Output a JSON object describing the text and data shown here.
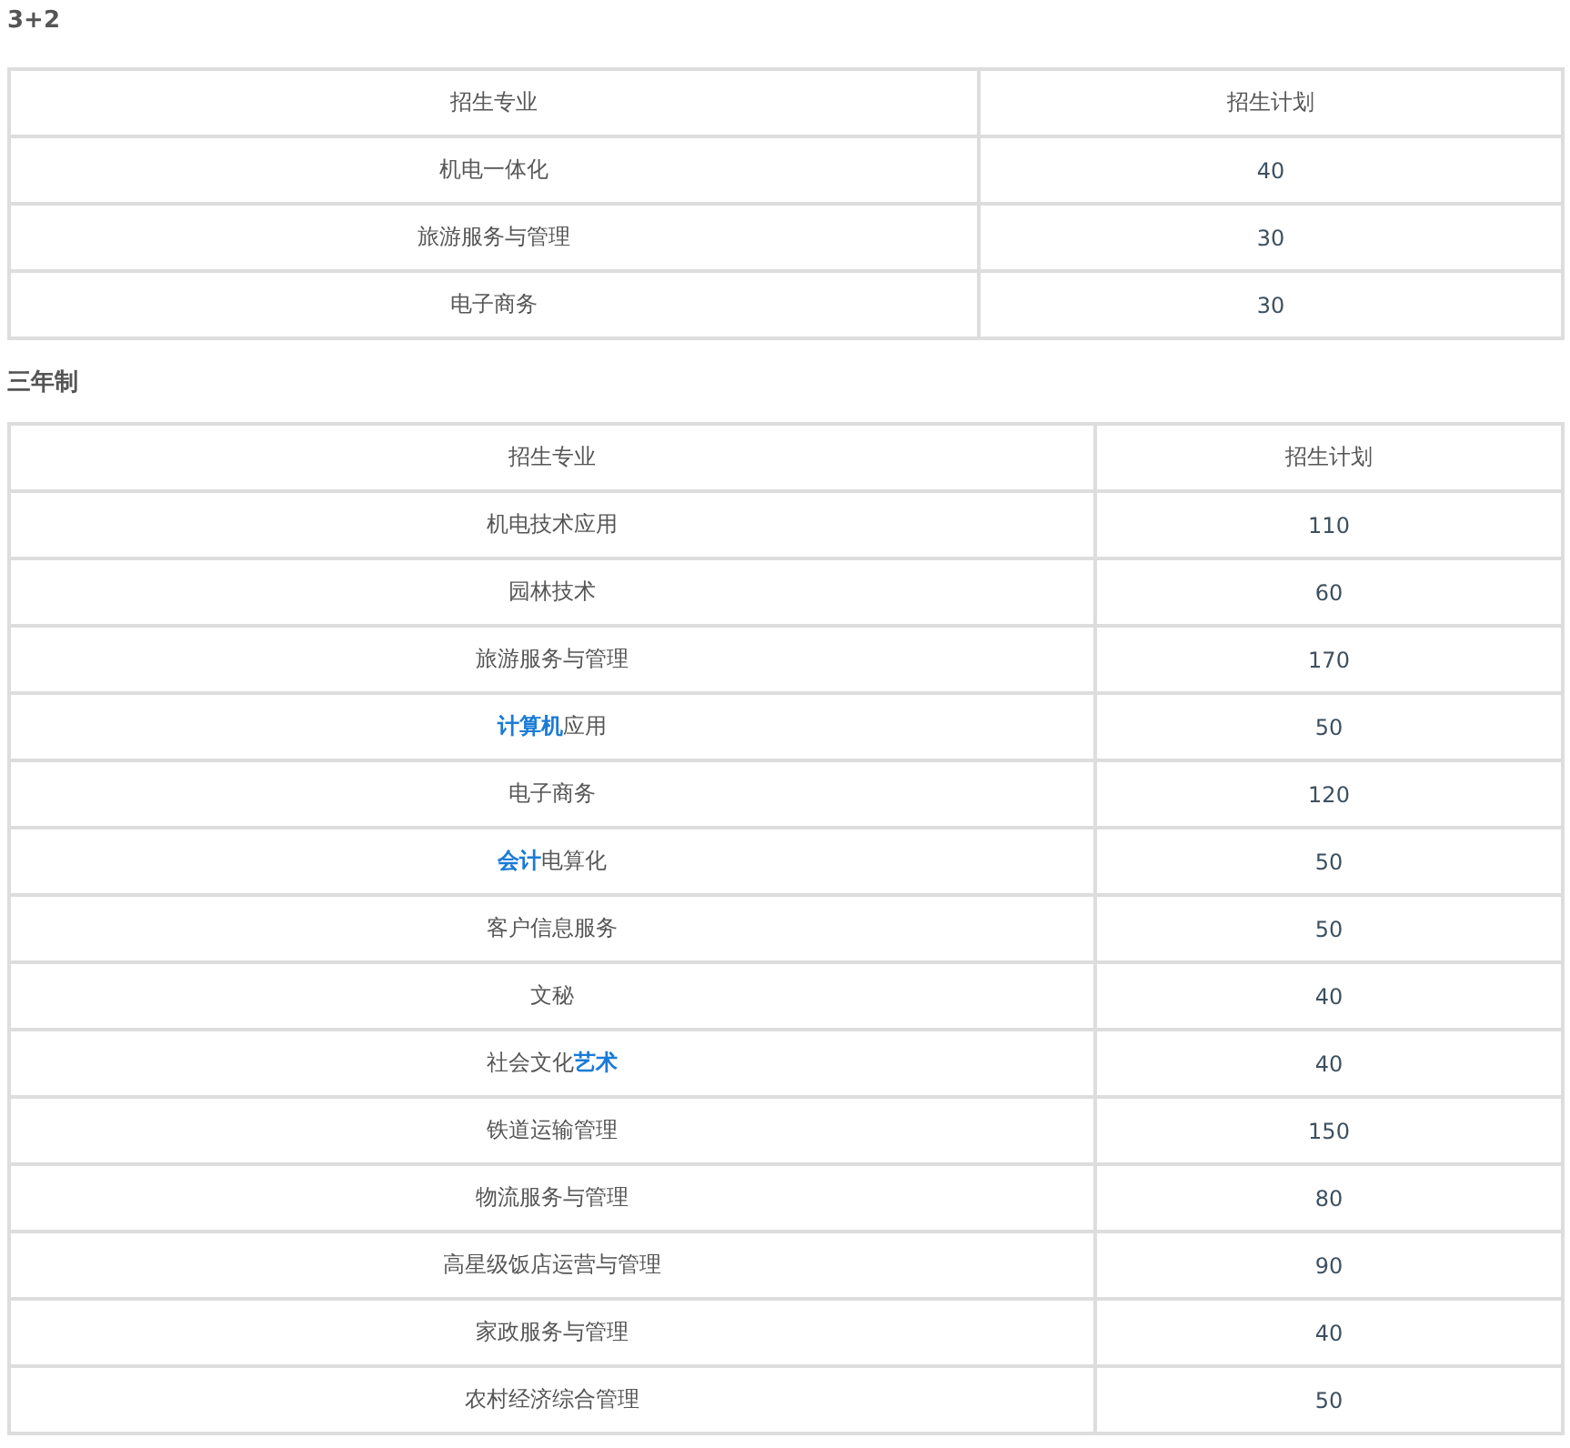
{
  "sections": [
    {
      "heading": "3+2",
      "columns": [
        "招生专业",
        "招生计划"
      ],
      "rows": [
        {
          "major": [
            {
              "text": "机电一体化",
              "link": false
            }
          ],
          "plan": "40"
        },
        {
          "major": [
            {
              "text": "旅游服务与管理",
              "link": false
            }
          ],
          "plan": "30"
        },
        {
          "major": [
            {
              "text": "电子商务",
              "link": false
            }
          ],
          "plan": "30"
        }
      ]
    },
    {
      "heading": "三年制",
      "columns": [
        "招生专业",
        "招生计划"
      ],
      "rows": [
        {
          "major": [
            {
              "text": "机电技术应用",
              "link": false
            }
          ],
          "plan": "110"
        },
        {
          "major": [
            {
              "text": "园林技术",
              "link": false
            }
          ],
          "plan": "60"
        },
        {
          "major": [
            {
              "text": "旅游服务与管理",
              "link": false
            }
          ],
          "plan": "170"
        },
        {
          "major": [
            {
              "text": "计算机",
              "link": true
            },
            {
              "text": "应用",
              "link": false
            }
          ],
          "plan": "50"
        },
        {
          "major": [
            {
              "text": "电子商务",
              "link": false
            }
          ],
          "plan": "120"
        },
        {
          "major": [
            {
              "text": "会计",
              "link": true
            },
            {
              "text": "电算化",
              "link": false
            }
          ],
          "plan": "50"
        },
        {
          "major": [
            {
              "text": "客户信息服务",
              "link": false
            }
          ],
          "plan": "50"
        },
        {
          "major": [
            {
              "text": "文秘",
              "link": false
            }
          ],
          "plan": "40"
        },
        {
          "major": [
            {
              "text": "社会文化",
              "link": false
            },
            {
              "text": "艺术",
              "link": true
            }
          ],
          "plan": "40"
        },
        {
          "major": [
            {
              "text": "铁道运输管理",
              "link": false
            }
          ],
          "plan": "150"
        },
        {
          "major": [
            {
              "text": "物流服务与管理",
              "link": false
            }
          ],
          "plan": "80"
        },
        {
          "major": [
            {
              "text": "高星级饭店运营与管理",
              "link": false
            }
          ],
          "plan": "90"
        },
        {
          "major": [
            {
              "text": "家政服务与管理",
              "link": false
            }
          ],
          "plan": "40"
        },
        {
          "major": [
            {
              "text": "农村经济综合管理",
              "link": false
            }
          ],
          "plan": "50"
        }
      ]
    }
  ]
}
